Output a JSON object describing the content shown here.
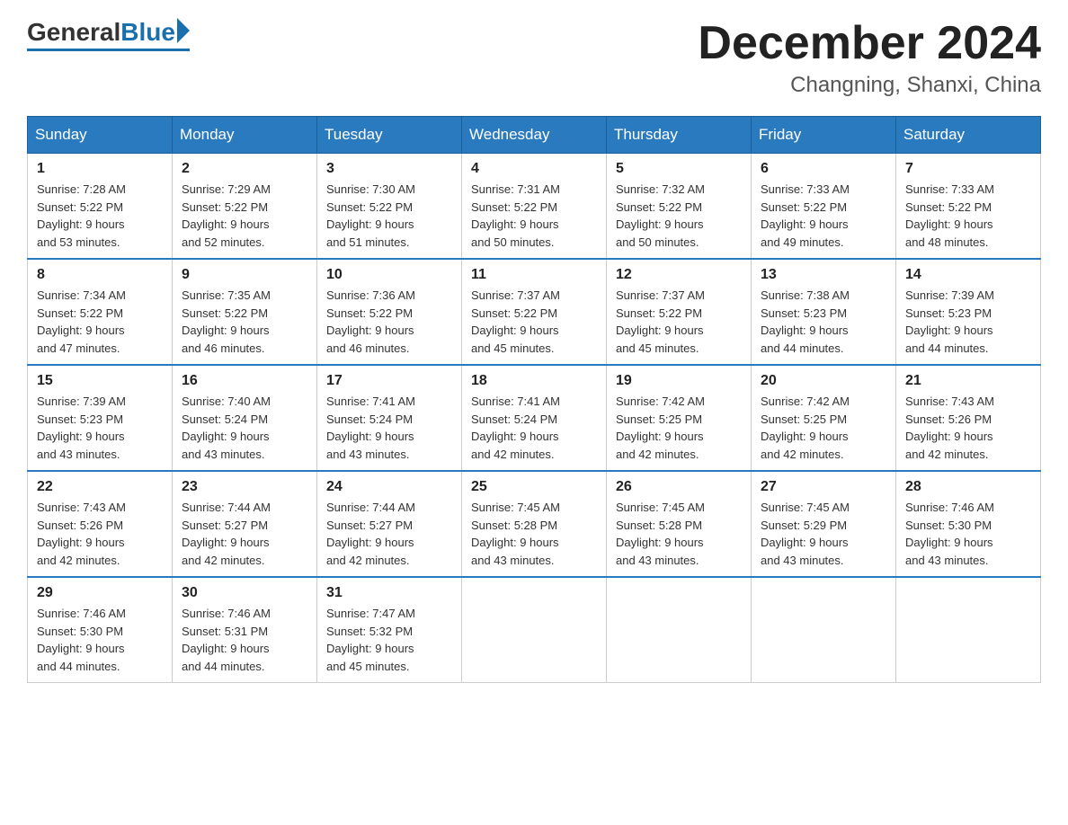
{
  "header": {
    "logo_general": "General",
    "logo_blue": "Blue",
    "month_title": "December 2024",
    "subtitle": "Changning, Shanxi, China"
  },
  "weekdays": [
    "Sunday",
    "Monday",
    "Tuesday",
    "Wednesday",
    "Thursday",
    "Friday",
    "Saturday"
  ],
  "weeks": [
    [
      {
        "day": "1",
        "sunrise": "7:28 AM",
        "sunset": "5:22 PM",
        "daylight": "9 hours and 53 minutes."
      },
      {
        "day": "2",
        "sunrise": "7:29 AM",
        "sunset": "5:22 PM",
        "daylight": "9 hours and 52 minutes."
      },
      {
        "day": "3",
        "sunrise": "7:30 AM",
        "sunset": "5:22 PM",
        "daylight": "9 hours and 51 minutes."
      },
      {
        "day": "4",
        "sunrise": "7:31 AM",
        "sunset": "5:22 PM",
        "daylight": "9 hours and 50 minutes."
      },
      {
        "day": "5",
        "sunrise": "7:32 AM",
        "sunset": "5:22 PM",
        "daylight": "9 hours and 50 minutes."
      },
      {
        "day": "6",
        "sunrise": "7:33 AM",
        "sunset": "5:22 PM",
        "daylight": "9 hours and 49 minutes."
      },
      {
        "day": "7",
        "sunrise": "7:33 AM",
        "sunset": "5:22 PM",
        "daylight": "9 hours and 48 minutes."
      }
    ],
    [
      {
        "day": "8",
        "sunrise": "7:34 AM",
        "sunset": "5:22 PM",
        "daylight": "9 hours and 47 minutes."
      },
      {
        "day": "9",
        "sunrise": "7:35 AM",
        "sunset": "5:22 PM",
        "daylight": "9 hours and 46 minutes."
      },
      {
        "day": "10",
        "sunrise": "7:36 AM",
        "sunset": "5:22 PM",
        "daylight": "9 hours and 46 minutes."
      },
      {
        "day": "11",
        "sunrise": "7:37 AM",
        "sunset": "5:22 PM",
        "daylight": "9 hours and 45 minutes."
      },
      {
        "day": "12",
        "sunrise": "7:37 AM",
        "sunset": "5:22 PM",
        "daylight": "9 hours and 45 minutes."
      },
      {
        "day": "13",
        "sunrise": "7:38 AM",
        "sunset": "5:23 PM",
        "daylight": "9 hours and 44 minutes."
      },
      {
        "day": "14",
        "sunrise": "7:39 AM",
        "sunset": "5:23 PM",
        "daylight": "9 hours and 44 minutes."
      }
    ],
    [
      {
        "day": "15",
        "sunrise": "7:39 AM",
        "sunset": "5:23 PM",
        "daylight": "9 hours and 43 minutes."
      },
      {
        "day": "16",
        "sunrise": "7:40 AM",
        "sunset": "5:24 PM",
        "daylight": "9 hours and 43 minutes."
      },
      {
        "day": "17",
        "sunrise": "7:41 AM",
        "sunset": "5:24 PM",
        "daylight": "9 hours and 43 minutes."
      },
      {
        "day": "18",
        "sunrise": "7:41 AM",
        "sunset": "5:24 PM",
        "daylight": "9 hours and 42 minutes."
      },
      {
        "day": "19",
        "sunrise": "7:42 AM",
        "sunset": "5:25 PM",
        "daylight": "9 hours and 42 minutes."
      },
      {
        "day": "20",
        "sunrise": "7:42 AM",
        "sunset": "5:25 PM",
        "daylight": "9 hours and 42 minutes."
      },
      {
        "day": "21",
        "sunrise": "7:43 AM",
        "sunset": "5:26 PM",
        "daylight": "9 hours and 42 minutes."
      }
    ],
    [
      {
        "day": "22",
        "sunrise": "7:43 AM",
        "sunset": "5:26 PM",
        "daylight": "9 hours and 42 minutes."
      },
      {
        "day": "23",
        "sunrise": "7:44 AM",
        "sunset": "5:27 PM",
        "daylight": "9 hours and 42 minutes."
      },
      {
        "day": "24",
        "sunrise": "7:44 AM",
        "sunset": "5:27 PM",
        "daylight": "9 hours and 42 minutes."
      },
      {
        "day": "25",
        "sunrise": "7:45 AM",
        "sunset": "5:28 PM",
        "daylight": "9 hours and 43 minutes."
      },
      {
        "day": "26",
        "sunrise": "7:45 AM",
        "sunset": "5:28 PM",
        "daylight": "9 hours and 43 minutes."
      },
      {
        "day": "27",
        "sunrise": "7:45 AM",
        "sunset": "5:29 PM",
        "daylight": "9 hours and 43 minutes."
      },
      {
        "day": "28",
        "sunrise": "7:46 AM",
        "sunset": "5:30 PM",
        "daylight": "9 hours and 43 minutes."
      }
    ],
    [
      {
        "day": "29",
        "sunrise": "7:46 AM",
        "sunset": "5:30 PM",
        "daylight": "9 hours and 44 minutes."
      },
      {
        "day": "30",
        "sunrise": "7:46 AM",
        "sunset": "5:31 PM",
        "daylight": "9 hours and 44 minutes."
      },
      {
        "day": "31",
        "sunrise": "7:47 AM",
        "sunset": "5:32 PM",
        "daylight": "9 hours and 45 minutes."
      },
      null,
      null,
      null,
      null
    ]
  ],
  "labels": {
    "sunrise": "Sunrise:",
    "sunset": "Sunset:",
    "daylight": "Daylight:"
  }
}
